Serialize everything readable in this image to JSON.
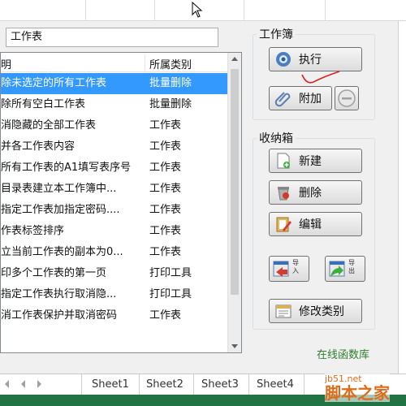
{
  "search": {
    "value": "工作表"
  },
  "list": {
    "headers": [
      "明",
      "所属类别"
    ],
    "rows": [
      {
        "name": "除未选定的所有工作表",
        "category": "批量删除",
        "selected": true
      },
      {
        "name": "除所有空白工作表",
        "category": "批量删除"
      },
      {
        "name": "消隐藏的全部工作表",
        "category": "工作表"
      },
      {
        "name": "并各工作表内容",
        "category": "工作表"
      },
      {
        "name": "所有工作表的A1填写表序号",
        "category": "工作表"
      },
      {
        "name": "目录表建立本工作簿中...",
        "category": "工作表"
      },
      {
        "name": "指定工作表加指定密码....",
        "category": "工作表"
      },
      {
        "name": "作表标签排序",
        "category": "工作表"
      },
      {
        "name": "立当前工作表的副本为0...",
        "category": "工作表"
      },
      {
        "name": "印多个工作表的第一页",
        "category": "打印工具"
      },
      {
        "name": "指定工作表执行取消隐...",
        "category": "打印工具"
      },
      {
        "name": "消工作表保护并取消密码",
        "category": "工作表"
      }
    ]
  },
  "workbook_group": {
    "title": "工作簿",
    "execute_label": "执行",
    "attach_label": "附加"
  },
  "storage_group": {
    "title": "收纳箱",
    "new_label": "新建",
    "delete_label": "删除",
    "edit_label": "编辑",
    "import_label": "导入",
    "export_label": "导出",
    "modify_category_label": "修改类别"
  },
  "online_label": "在线函数库",
  "sheet_tabs": [
    "Sheet1",
    "Sheet2",
    "Sheet3",
    "Sheet4"
  ],
  "watermark": {
    "top": "jb51.net",
    "bottom": "脚本之家"
  },
  "colors": {
    "selection": "#3399ff",
    "status_bar": "#217346",
    "online_text": "#2f7d2f"
  }
}
